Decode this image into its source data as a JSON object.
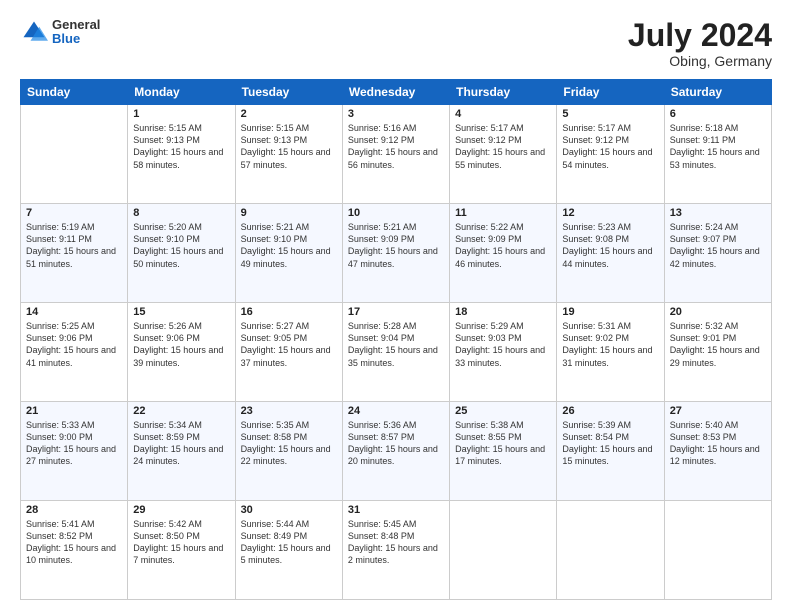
{
  "header": {
    "logo": {
      "general": "General",
      "blue": "Blue"
    },
    "title": "July 2024",
    "location": "Obing, Germany"
  },
  "calendar": {
    "columns": [
      "Sunday",
      "Monday",
      "Tuesday",
      "Wednesday",
      "Thursday",
      "Friday",
      "Saturday"
    ],
    "weeks": [
      [
        {
          "day": "",
          "sunrise": "",
          "sunset": "",
          "daylight": ""
        },
        {
          "day": "1",
          "sunrise": "Sunrise: 5:15 AM",
          "sunset": "Sunset: 9:13 PM",
          "daylight": "Daylight: 15 hours and 58 minutes."
        },
        {
          "day": "2",
          "sunrise": "Sunrise: 5:15 AM",
          "sunset": "Sunset: 9:13 PM",
          "daylight": "Daylight: 15 hours and 57 minutes."
        },
        {
          "day": "3",
          "sunrise": "Sunrise: 5:16 AM",
          "sunset": "Sunset: 9:12 PM",
          "daylight": "Daylight: 15 hours and 56 minutes."
        },
        {
          "day": "4",
          "sunrise": "Sunrise: 5:17 AM",
          "sunset": "Sunset: 9:12 PM",
          "daylight": "Daylight: 15 hours and 55 minutes."
        },
        {
          "day": "5",
          "sunrise": "Sunrise: 5:17 AM",
          "sunset": "Sunset: 9:12 PM",
          "daylight": "Daylight: 15 hours and 54 minutes."
        },
        {
          "day": "6",
          "sunrise": "Sunrise: 5:18 AM",
          "sunset": "Sunset: 9:11 PM",
          "daylight": "Daylight: 15 hours and 53 minutes."
        }
      ],
      [
        {
          "day": "7",
          "sunrise": "Sunrise: 5:19 AM",
          "sunset": "Sunset: 9:11 PM",
          "daylight": "Daylight: 15 hours and 51 minutes."
        },
        {
          "day": "8",
          "sunrise": "Sunrise: 5:20 AM",
          "sunset": "Sunset: 9:10 PM",
          "daylight": "Daylight: 15 hours and 50 minutes."
        },
        {
          "day": "9",
          "sunrise": "Sunrise: 5:21 AM",
          "sunset": "Sunset: 9:10 PM",
          "daylight": "Daylight: 15 hours and 49 minutes."
        },
        {
          "day": "10",
          "sunrise": "Sunrise: 5:21 AM",
          "sunset": "Sunset: 9:09 PM",
          "daylight": "Daylight: 15 hours and 47 minutes."
        },
        {
          "day": "11",
          "sunrise": "Sunrise: 5:22 AM",
          "sunset": "Sunset: 9:09 PM",
          "daylight": "Daylight: 15 hours and 46 minutes."
        },
        {
          "day": "12",
          "sunrise": "Sunrise: 5:23 AM",
          "sunset": "Sunset: 9:08 PM",
          "daylight": "Daylight: 15 hours and 44 minutes."
        },
        {
          "day": "13",
          "sunrise": "Sunrise: 5:24 AM",
          "sunset": "Sunset: 9:07 PM",
          "daylight": "Daylight: 15 hours and 42 minutes."
        }
      ],
      [
        {
          "day": "14",
          "sunrise": "Sunrise: 5:25 AM",
          "sunset": "Sunset: 9:06 PM",
          "daylight": "Daylight: 15 hours and 41 minutes."
        },
        {
          "day": "15",
          "sunrise": "Sunrise: 5:26 AM",
          "sunset": "Sunset: 9:06 PM",
          "daylight": "Daylight: 15 hours and 39 minutes."
        },
        {
          "day": "16",
          "sunrise": "Sunrise: 5:27 AM",
          "sunset": "Sunset: 9:05 PM",
          "daylight": "Daylight: 15 hours and 37 minutes."
        },
        {
          "day": "17",
          "sunrise": "Sunrise: 5:28 AM",
          "sunset": "Sunset: 9:04 PM",
          "daylight": "Daylight: 15 hours and 35 minutes."
        },
        {
          "day": "18",
          "sunrise": "Sunrise: 5:29 AM",
          "sunset": "Sunset: 9:03 PM",
          "daylight": "Daylight: 15 hours and 33 minutes."
        },
        {
          "day": "19",
          "sunrise": "Sunrise: 5:31 AM",
          "sunset": "Sunset: 9:02 PM",
          "daylight": "Daylight: 15 hours and 31 minutes."
        },
        {
          "day": "20",
          "sunrise": "Sunrise: 5:32 AM",
          "sunset": "Sunset: 9:01 PM",
          "daylight": "Daylight: 15 hours and 29 minutes."
        }
      ],
      [
        {
          "day": "21",
          "sunrise": "Sunrise: 5:33 AM",
          "sunset": "Sunset: 9:00 PM",
          "daylight": "Daylight: 15 hours and 27 minutes."
        },
        {
          "day": "22",
          "sunrise": "Sunrise: 5:34 AM",
          "sunset": "Sunset: 8:59 PM",
          "daylight": "Daylight: 15 hours and 24 minutes."
        },
        {
          "day": "23",
          "sunrise": "Sunrise: 5:35 AM",
          "sunset": "Sunset: 8:58 PM",
          "daylight": "Daylight: 15 hours and 22 minutes."
        },
        {
          "day": "24",
          "sunrise": "Sunrise: 5:36 AM",
          "sunset": "Sunset: 8:57 PM",
          "daylight": "Daylight: 15 hours and 20 minutes."
        },
        {
          "day": "25",
          "sunrise": "Sunrise: 5:38 AM",
          "sunset": "Sunset: 8:55 PM",
          "daylight": "Daylight: 15 hours and 17 minutes."
        },
        {
          "day": "26",
          "sunrise": "Sunrise: 5:39 AM",
          "sunset": "Sunset: 8:54 PM",
          "daylight": "Daylight: 15 hours and 15 minutes."
        },
        {
          "day": "27",
          "sunrise": "Sunrise: 5:40 AM",
          "sunset": "Sunset: 8:53 PM",
          "daylight": "Daylight: 15 hours and 12 minutes."
        }
      ],
      [
        {
          "day": "28",
          "sunrise": "Sunrise: 5:41 AM",
          "sunset": "Sunset: 8:52 PM",
          "daylight": "Daylight: 15 hours and 10 minutes."
        },
        {
          "day": "29",
          "sunrise": "Sunrise: 5:42 AM",
          "sunset": "Sunset: 8:50 PM",
          "daylight": "Daylight: 15 hours and 7 minutes."
        },
        {
          "day": "30",
          "sunrise": "Sunrise: 5:44 AM",
          "sunset": "Sunset: 8:49 PM",
          "daylight": "Daylight: 15 hours and 5 minutes."
        },
        {
          "day": "31",
          "sunrise": "Sunrise: 5:45 AM",
          "sunset": "Sunset: 8:48 PM",
          "daylight": "Daylight: 15 hours and 2 minutes."
        },
        {
          "day": "",
          "sunrise": "",
          "sunset": "",
          "daylight": ""
        },
        {
          "day": "",
          "sunrise": "",
          "sunset": "",
          "daylight": ""
        },
        {
          "day": "",
          "sunrise": "",
          "sunset": "",
          "daylight": ""
        }
      ]
    ]
  }
}
